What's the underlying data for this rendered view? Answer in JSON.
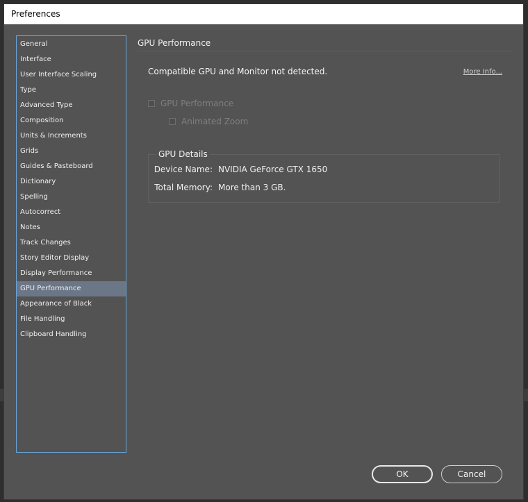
{
  "window": {
    "title": "Preferences"
  },
  "sidebar": {
    "items": [
      {
        "label": "General",
        "selected": false
      },
      {
        "label": "Interface",
        "selected": false
      },
      {
        "label": "User Interface Scaling",
        "selected": false
      },
      {
        "label": "Type",
        "selected": false
      },
      {
        "label": "Advanced Type",
        "selected": false
      },
      {
        "label": "Composition",
        "selected": false
      },
      {
        "label": "Units & Increments",
        "selected": false
      },
      {
        "label": "Grids",
        "selected": false
      },
      {
        "label": "Guides & Pasteboard",
        "selected": false
      },
      {
        "label": "Dictionary",
        "selected": false
      },
      {
        "label": "Spelling",
        "selected": false
      },
      {
        "label": "Autocorrect",
        "selected": false
      },
      {
        "label": "Notes",
        "selected": false
      },
      {
        "label": "Track Changes",
        "selected": false
      },
      {
        "label": "Story Editor Display",
        "selected": false
      },
      {
        "label": "Display Performance",
        "selected": false
      },
      {
        "label": "GPU Performance",
        "selected": true
      },
      {
        "label": "Appearance of Black",
        "selected": false
      },
      {
        "label": "File Handling",
        "selected": false
      },
      {
        "label": "Clipboard Handling",
        "selected": false
      }
    ]
  },
  "main": {
    "section_title": "GPU Performance",
    "status_text": "Compatible GPU and Monitor not detected.",
    "more_info_link": "More Info...",
    "gpu_performance_checkbox": {
      "label": "GPU Performance",
      "checked": false,
      "enabled": false
    },
    "animated_zoom_checkbox": {
      "label": "Animated Zoom",
      "checked": false,
      "enabled": false
    },
    "gpu_details": {
      "title": "GPU Details",
      "device_name_label": "Device Name:",
      "device_name_value": "NVIDIA GeForce GTX 1650",
      "total_memory_label": "Total Memory:",
      "total_memory_value": "More than 3 GB."
    }
  },
  "buttons": {
    "ok_label": "OK",
    "cancel_label": "Cancel"
  },
  "colors": {
    "selection": "#6b7687",
    "sidebar_border": "#6aa6dd",
    "panel_background": "#535353"
  }
}
